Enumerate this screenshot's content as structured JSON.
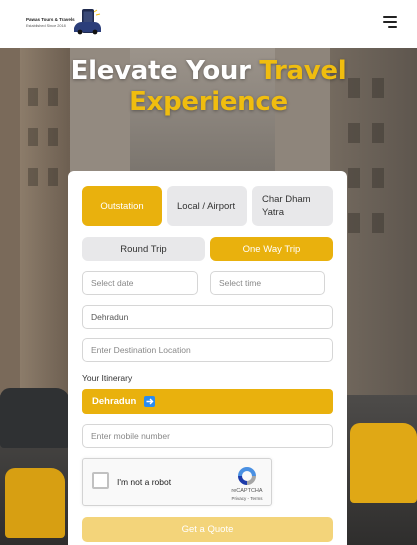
{
  "brand": {
    "name": "Pawas Tours & Travels",
    "tagline": "Established Since 2018"
  },
  "hero": {
    "headline_line1_white": "Elevate Your ",
    "headline_line1_gold": "Travel",
    "headline_line2_gold": "Experience"
  },
  "trip_category_tabs": [
    {
      "label": "Outstation",
      "selected": true
    },
    {
      "label": "Local / Airport",
      "selected": false
    },
    {
      "label": "Char Dham Yatra",
      "selected": false
    }
  ],
  "trip_type_tabs": [
    {
      "label": "Round Trip",
      "selected": false
    },
    {
      "label": "One Way Trip",
      "selected": true
    }
  ],
  "form": {
    "date_placeholder": "Select date",
    "time_placeholder": "Select time",
    "pickup_value": "Dehradun",
    "destination_placeholder": "Enter Destination Location",
    "itinerary_label": "Your Itinerary",
    "itinerary_value": "Dehradun",
    "mobile_placeholder": "Enter mobile number",
    "submit_label": "Get a Quote"
  },
  "recaptcha": {
    "label": "I'm not a robot",
    "brand": "reCAPTCHA",
    "links": "Privacy - Terms"
  },
  "colors": {
    "accent": "#e9b10d",
    "accent_disabled": "#f3d47a",
    "tab_inactive": "#e8e8ea",
    "headline_gold": "#f0bd0f"
  }
}
